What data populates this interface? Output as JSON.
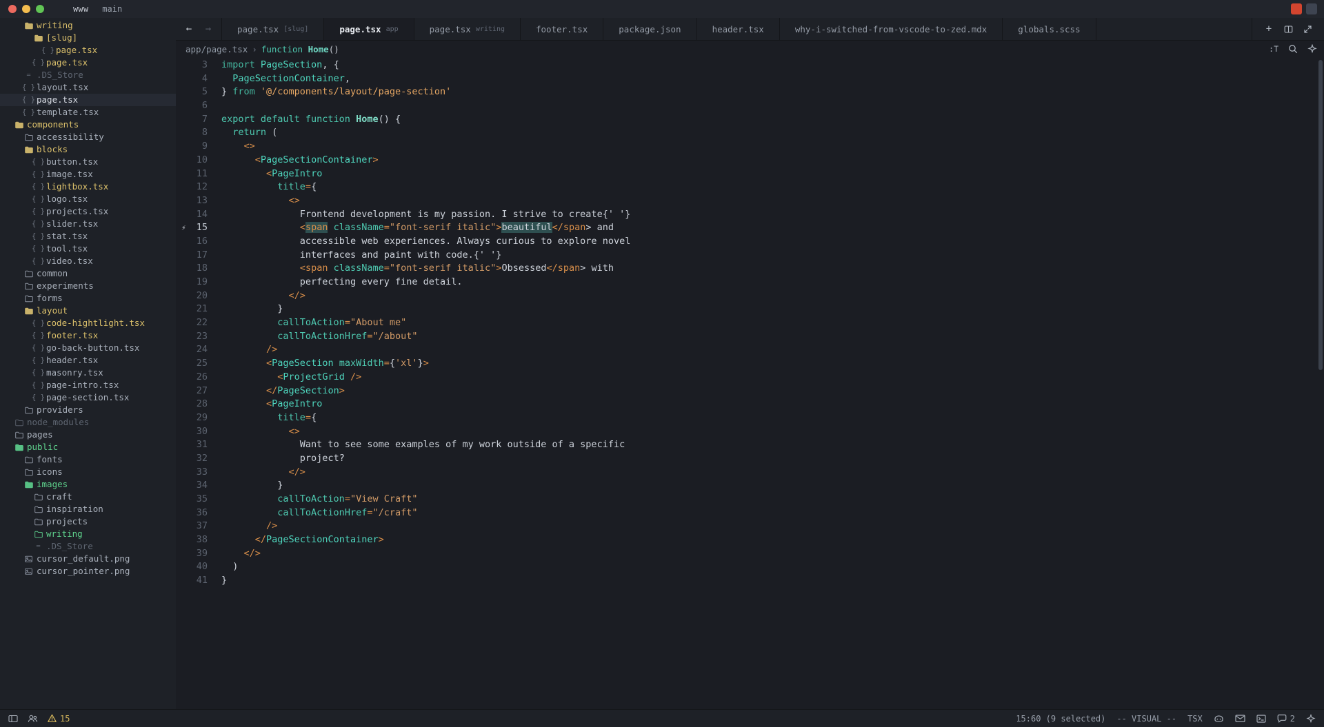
{
  "titlebar": {
    "project": "www",
    "branch": "main",
    "traffic": [
      "close-red",
      "minimize-yellow",
      "maximize-green"
    ]
  },
  "sidebar": {
    "items": [
      {
        "label": "writing",
        "depth": 2,
        "icon": "folder-open",
        "color": "yellow",
        "kind": "dir"
      },
      {
        "label": "[slug]",
        "depth": 3,
        "icon": "folder-open",
        "color": "yellow",
        "kind": "dir"
      },
      {
        "label": "page.tsx",
        "depth": 4,
        "icon": "braces",
        "color": "yellow",
        "kind": "file"
      },
      {
        "label": "page.tsx",
        "depth": 3,
        "icon": "braces",
        "color": "yellow",
        "kind": "file"
      },
      {
        "label": ".DS_Store",
        "depth": 2,
        "icon": "dash",
        "color": "dim",
        "kind": "file"
      },
      {
        "label": "layout.tsx",
        "depth": 2,
        "icon": "braces",
        "color": "norm",
        "kind": "file"
      },
      {
        "label": "page.tsx",
        "depth": 2,
        "icon": "braces",
        "color": "white",
        "kind": "file",
        "selected": true
      },
      {
        "label": "template.tsx",
        "depth": 2,
        "icon": "braces",
        "color": "norm",
        "kind": "file"
      },
      {
        "label": "components",
        "depth": 1,
        "icon": "folder-open",
        "color": "yellow",
        "kind": "dir"
      },
      {
        "label": "accessibility",
        "depth": 2,
        "icon": "folder",
        "color": "norm",
        "kind": "dir"
      },
      {
        "label": "blocks",
        "depth": 2,
        "icon": "folder-open",
        "color": "yellow",
        "kind": "dir"
      },
      {
        "label": "button.tsx",
        "depth": 3,
        "icon": "braces",
        "color": "norm",
        "kind": "file"
      },
      {
        "label": "image.tsx",
        "depth": 3,
        "icon": "braces",
        "color": "norm",
        "kind": "file"
      },
      {
        "label": "lightbox.tsx",
        "depth": 3,
        "icon": "braces",
        "color": "yellow",
        "kind": "file"
      },
      {
        "label": "logo.tsx",
        "depth": 3,
        "icon": "braces",
        "color": "norm",
        "kind": "file"
      },
      {
        "label": "projects.tsx",
        "depth": 3,
        "icon": "braces",
        "color": "norm",
        "kind": "file"
      },
      {
        "label": "slider.tsx",
        "depth": 3,
        "icon": "braces",
        "color": "norm",
        "kind": "file"
      },
      {
        "label": "stat.tsx",
        "depth": 3,
        "icon": "braces",
        "color": "norm",
        "kind": "file"
      },
      {
        "label": "tool.tsx",
        "depth": 3,
        "icon": "braces",
        "color": "norm",
        "kind": "file"
      },
      {
        "label": "video.tsx",
        "depth": 3,
        "icon": "braces",
        "color": "norm",
        "kind": "file"
      },
      {
        "label": "common",
        "depth": 2,
        "icon": "folder",
        "color": "norm",
        "kind": "dir"
      },
      {
        "label": "experiments",
        "depth": 2,
        "icon": "folder",
        "color": "norm",
        "kind": "dir"
      },
      {
        "label": "forms",
        "depth": 2,
        "icon": "folder",
        "color": "norm",
        "kind": "dir"
      },
      {
        "label": "layout",
        "depth": 2,
        "icon": "folder-open",
        "color": "yellow",
        "kind": "dir"
      },
      {
        "label": "code-hightlight.tsx",
        "depth": 3,
        "icon": "braces",
        "color": "yellow",
        "kind": "file"
      },
      {
        "label": "footer.tsx",
        "depth": 3,
        "icon": "braces",
        "color": "yellow",
        "kind": "file"
      },
      {
        "label": "go-back-button.tsx",
        "depth": 3,
        "icon": "braces",
        "color": "norm",
        "kind": "file"
      },
      {
        "label": "header.tsx",
        "depth": 3,
        "icon": "braces",
        "color": "norm",
        "kind": "file"
      },
      {
        "label": "masonry.tsx",
        "depth": 3,
        "icon": "braces",
        "color": "norm",
        "kind": "file"
      },
      {
        "label": "page-intro.tsx",
        "depth": 3,
        "icon": "braces",
        "color": "norm",
        "kind": "file"
      },
      {
        "label": "page-section.tsx",
        "depth": 3,
        "icon": "braces",
        "color": "norm",
        "kind": "file"
      },
      {
        "label": "providers",
        "depth": 2,
        "icon": "folder",
        "color": "norm",
        "kind": "dir"
      },
      {
        "label": "node_modules",
        "depth": 1,
        "icon": "folder",
        "color": "dim",
        "kind": "dir"
      },
      {
        "label": "pages",
        "depth": 1,
        "icon": "folder",
        "color": "norm",
        "kind": "dir"
      },
      {
        "label": "public",
        "depth": 1,
        "icon": "folder-open",
        "color": "green",
        "kind": "dir"
      },
      {
        "label": "fonts",
        "depth": 2,
        "icon": "folder",
        "color": "norm",
        "kind": "dir"
      },
      {
        "label": "icons",
        "depth": 2,
        "icon": "folder",
        "color": "norm",
        "kind": "dir"
      },
      {
        "label": "images",
        "depth": 2,
        "icon": "folder-open",
        "color": "green",
        "kind": "dir"
      },
      {
        "label": "craft",
        "depth": 3,
        "icon": "folder",
        "color": "norm",
        "kind": "dir"
      },
      {
        "label": "inspiration",
        "depth": 3,
        "icon": "folder",
        "color": "norm",
        "kind": "dir"
      },
      {
        "label": "projects",
        "depth": 3,
        "icon": "folder",
        "color": "norm",
        "kind": "dir"
      },
      {
        "label": "writing",
        "depth": 3,
        "icon": "folder",
        "color": "green",
        "kind": "dir"
      },
      {
        "label": ".DS_Store",
        "depth": 3,
        "icon": "dash",
        "color": "dim",
        "kind": "file"
      },
      {
        "label": "cursor_default.png",
        "depth": 2,
        "icon": "image",
        "color": "norm",
        "kind": "file"
      },
      {
        "label": "cursor_pointer.png",
        "depth": 2,
        "icon": "image",
        "color": "norm",
        "kind": "file"
      }
    ]
  },
  "tabbar": {
    "back_icon": "arrow-left-icon",
    "forward_icon": "arrow-right-icon",
    "tabs": [
      {
        "label": "page.tsx",
        "sub": "[slug]",
        "active": false
      },
      {
        "label": "page.tsx",
        "sub": "app",
        "active": true
      },
      {
        "label": "page.tsx",
        "sub": "writing",
        "active": false
      },
      {
        "label": "footer.tsx",
        "sub": "",
        "active": false
      },
      {
        "label": "package.json",
        "sub": "",
        "active": false
      },
      {
        "label": "header.tsx",
        "sub": "",
        "active": false
      },
      {
        "label": "why-i-switched-from-vscode-to-zed.mdx",
        "sub": "",
        "active": false
      },
      {
        "label": "globals.scss",
        "sub": "",
        "active": false
      }
    ],
    "actions": [
      {
        "name": "new-tab-button",
        "glyph": "+"
      },
      {
        "name": "split-pane-button",
        "glyph": "▥"
      },
      {
        "name": "expand-button",
        "glyph": "⤢"
      }
    ]
  },
  "breadcrumb": {
    "path": "app/page.tsx",
    "separator": "›",
    "symbol_keyword": "function",
    "symbol_name": "Home",
    "symbol_parens": "()",
    "actions": [
      {
        "name": "toggle-inlay-hints-button",
        "glyph": ":T"
      },
      {
        "name": "buffer-search-button",
        "glyph": "search-icon"
      },
      {
        "name": "assistant-button",
        "glyph": "sparkle-icon"
      }
    ]
  },
  "code": {
    "lines": [
      {
        "n": 3,
        "tokens": [
          {
            "t": "import ",
            "c": "kw"
          },
          {
            "t": "PageSection",
            "c": "ty"
          },
          {
            "t": ", {",
            "c": "tx"
          }
        ],
        "indent": 0
      },
      {
        "n": 4,
        "tokens": [
          {
            "t": "PageSectionContainer",
            "c": "ty"
          },
          {
            "t": ",",
            "c": "tx"
          }
        ],
        "indent": 1
      },
      {
        "n": 5,
        "tokens": [
          {
            "t": "} ",
            "c": "tx"
          },
          {
            "t": "from ",
            "c": "kw"
          },
          {
            "t": "'@/components/layout/page-section'",
            "c": "str"
          }
        ],
        "indent": 0
      },
      {
        "n": 6,
        "tokens": [],
        "indent": 0
      },
      {
        "n": 7,
        "tokens": [
          {
            "t": "export default function ",
            "c": "k"
          },
          {
            "t": "Home",
            "c": "fn"
          },
          {
            "t": "() {",
            "c": "tx"
          }
        ],
        "indent": 0
      },
      {
        "n": 8,
        "tokens": [
          {
            "t": "return",
            "c": "k"
          },
          {
            "t": " (",
            "c": "tx"
          }
        ],
        "indent": 1
      },
      {
        "n": 9,
        "tokens": [
          {
            "t": "<>",
            "c": "pn"
          }
        ],
        "indent": 2
      },
      {
        "n": 10,
        "tokens": [
          {
            "t": "<",
            "c": "pn"
          },
          {
            "t": "PageSectionContainer",
            "c": "ty"
          },
          {
            "t": ">",
            "c": "pn"
          }
        ],
        "indent": 3
      },
      {
        "n": 11,
        "tokens": [
          {
            "t": "<",
            "c": "pn"
          },
          {
            "t": "PageIntro",
            "c": "ty"
          }
        ],
        "indent": 4
      },
      {
        "n": 12,
        "tokens": [
          {
            "t": "title",
            "c": "k"
          },
          {
            "t": "=",
            "c": "pn"
          },
          {
            "t": "{",
            "c": "tx"
          }
        ],
        "indent": 5
      },
      {
        "n": 13,
        "tokens": [
          {
            "t": "<>",
            "c": "pn"
          }
        ],
        "indent": 6
      },
      {
        "n": 14,
        "tokens": [
          {
            "t": "Frontend development is my passion. I strive to create",
            "c": "tx"
          },
          {
            "t": "{' '}",
            "c": "tx"
          }
        ],
        "indent": 7
      },
      {
        "n": 15,
        "tokens": [
          {
            "t": "<",
            "c": "pn"
          },
          {
            "t": "span",
            "c": "pn",
            "sel": true
          },
          {
            "t": " ",
            "c": "tx"
          },
          {
            "t": "className",
            "c": "k"
          },
          {
            "t": "=",
            "c": "pn"
          },
          {
            "t": "\"font-serif italic\"",
            "c": "at"
          },
          {
            "t": ">",
            "c": "pn"
          },
          {
            "t": "beautiful",
            "c": "tx",
            "sel": true
          },
          {
            "t": "</",
            "c": "pn"
          },
          {
            "t": "span",
            "c": "pn"
          },
          {
            "t": "> and",
            "c": "tx"
          }
        ],
        "indent": 7,
        "current": true,
        "gutter_icon": "lightning-icon"
      },
      {
        "n": 16,
        "tokens": [
          {
            "t": "accessible web experiences. Always curious to explore novel",
            "c": "tx"
          }
        ],
        "indent": 7
      },
      {
        "n": 17,
        "tokens": [
          {
            "t": "interfaces and paint with code.",
            "c": "tx"
          },
          {
            "t": "{' '}",
            "c": "tx"
          }
        ],
        "indent": 7
      },
      {
        "n": 18,
        "tokens": [
          {
            "t": "<",
            "c": "pn"
          },
          {
            "t": "span",
            "c": "pn"
          },
          {
            "t": " ",
            "c": "tx"
          },
          {
            "t": "className",
            "c": "k"
          },
          {
            "t": "=",
            "c": "pn"
          },
          {
            "t": "\"font-serif italic\"",
            "c": "at"
          },
          {
            "t": ">",
            "c": "pn"
          },
          {
            "t": "Obsessed",
            "c": "tx"
          },
          {
            "t": "</",
            "c": "pn"
          },
          {
            "t": "span",
            "c": "pn"
          },
          {
            "t": "> with",
            "c": "tx"
          }
        ],
        "indent": 7
      },
      {
        "n": 19,
        "tokens": [
          {
            "t": "perfecting every fine detail.",
            "c": "tx"
          }
        ],
        "indent": 7
      },
      {
        "n": 20,
        "tokens": [
          {
            "t": "</>",
            "c": "pn"
          }
        ],
        "indent": 6
      },
      {
        "n": 21,
        "tokens": [
          {
            "t": "}",
            "c": "tx"
          }
        ],
        "indent": 5
      },
      {
        "n": 22,
        "tokens": [
          {
            "t": "callToAction",
            "c": "k"
          },
          {
            "t": "=",
            "c": "pn"
          },
          {
            "t": "\"About me\"",
            "c": "at"
          }
        ],
        "indent": 5
      },
      {
        "n": 23,
        "tokens": [
          {
            "t": "callToActionHref",
            "c": "k"
          },
          {
            "t": "=",
            "c": "pn"
          },
          {
            "t": "\"/about\"",
            "c": "at"
          }
        ],
        "indent": 5
      },
      {
        "n": 24,
        "tokens": [
          {
            "t": "/>",
            "c": "pn"
          }
        ],
        "indent": 4
      },
      {
        "n": 25,
        "tokens": [
          {
            "t": "<",
            "c": "pn"
          },
          {
            "t": "PageSection",
            "c": "ty"
          },
          {
            "t": " ",
            "c": "tx"
          },
          {
            "t": "maxWidth",
            "c": "k"
          },
          {
            "t": "=",
            "c": "pn"
          },
          {
            "t": "{",
            "c": "tx"
          },
          {
            "t": "'xl'",
            "c": "at"
          },
          {
            "t": "}",
            "c": "tx"
          },
          {
            "t": ">",
            "c": "pn"
          }
        ],
        "indent": 4
      },
      {
        "n": 26,
        "tokens": [
          {
            "t": "<",
            "c": "pn"
          },
          {
            "t": "ProjectGrid",
            "c": "ty"
          },
          {
            "t": " />",
            "c": "pn"
          }
        ],
        "indent": 5
      },
      {
        "n": 27,
        "tokens": [
          {
            "t": "</",
            "c": "pn"
          },
          {
            "t": "PageSection",
            "c": "ty"
          },
          {
            "t": ">",
            "c": "pn"
          }
        ],
        "indent": 4
      },
      {
        "n": 28,
        "tokens": [
          {
            "t": "<",
            "c": "pn"
          },
          {
            "t": "PageIntro",
            "c": "ty"
          }
        ],
        "indent": 4
      },
      {
        "n": 29,
        "tokens": [
          {
            "t": "title",
            "c": "k"
          },
          {
            "t": "=",
            "c": "pn"
          },
          {
            "t": "{",
            "c": "tx"
          }
        ],
        "indent": 5
      },
      {
        "n": 30,
        "tokens": [
          {
            "t": "<>",
            "c": "pn"
          }
        ],
        "indent": 6
      },
      {
        "n": 31,
        "tokens": [
          {
            "t": "Want to see some examples of my work outside of a specific",
            "c": "tx"
          }
        ],
        "indent": 7
      },
      {
        "n": 32,
        "tokens": [
          {
            "t": "project?",
            "c": "tx"
          }
        ],
        "indent": 7
      },
      {
        "n": 33,
        "tokens": [
          {
            "t": "</>",
            "c": "pn"
          }
        ],
        "indent": 6
      },
      {
        "n": 34,
        "tokens": [
          {
            "t": "}",
            "c": "tx"
          }
        ],
        "indent": 5
      },
      {
        "n": 35,
        "tokens": [
          {
            "t": "callToAction",
            "c": "k"
          },
          {
            "t": "=",
            "c": "pn"
          },
          {
            "t": "\"View Craft\"",
            "c": "at"
          }
        ],
        "indent": 5
      },
      {
        "n": 36,
        "tokens": [
          {
            "t": "callToActionHref",
            "c": "k"
          },
          {
            "t": "=",
            "c": "pn"
          },
          {
            "t": "\"/craft\"",
            "c": "at"
          }
        ],
        "indent": 5
      },
      {
        "n": 37,
        "tokens": [
          {
            "t": "/>",
            "c": "pn"
          }
        ],
        "indent": 4
      },
      {
        "n": 38,
        "tokens": [
          {
            "t": "</",
            "c": "pn"
          },
          {
            "t": "PageSectionContainer",
            "c": "ty"
          },
          {
            "t": ">",
            "c": "pn"
          }
        ],
        "indent": 3
      },
      {
        "n": 39,
        "tokens": [
          {
            "t": "</>",
            "c": "pn"
          }
        ],
        "indent": 2
      },
      {
        "n": 40,
        "tokens": [
          {
            "t": ")",
            "c": "tx"
          }
        ],
        "indent": 1
      },
      {
        "n": 41,
        "tokens": [
          {
            "t": "}",
            "c": "tx"
          }
        ],
        "indent": 0
      }
    ]
  },
  "statusbar": {
    "left": [
      {
        "name": "project-panel-toggle",
        "glyph": "panel-icon",
        "label": ""
      },
      {
        "name": "collab-panel-toggle",
        "glyph": "people-icon",
        "label": ""
      },
      {
        "name": "diagnostics-warnings",
        "glyph": "warning-icon",
        "label": "15"
      }
    ],
    "cursor_position": "15:60 (9 selected)",
    "mode": "-- VISUAL --",
    "language": "TSX",
    "right_icons": [
      {
        "name": "copilot-icon",
        "glyph": "◍"
      },
      {
        "name": "mail-icon",
        "glyph": "✉"
      },
      {
        "name": "terminal-icon",
        "glyph": "▣"
      },
      {
        "name": "chat-icon",
        "glyph": "💬",
        "count": "2"
      },
      {
        "name": "assistant-panel-icon",
        "glyph": "✦"
      }
    ],
    "chat_count": "2"
  }
}
